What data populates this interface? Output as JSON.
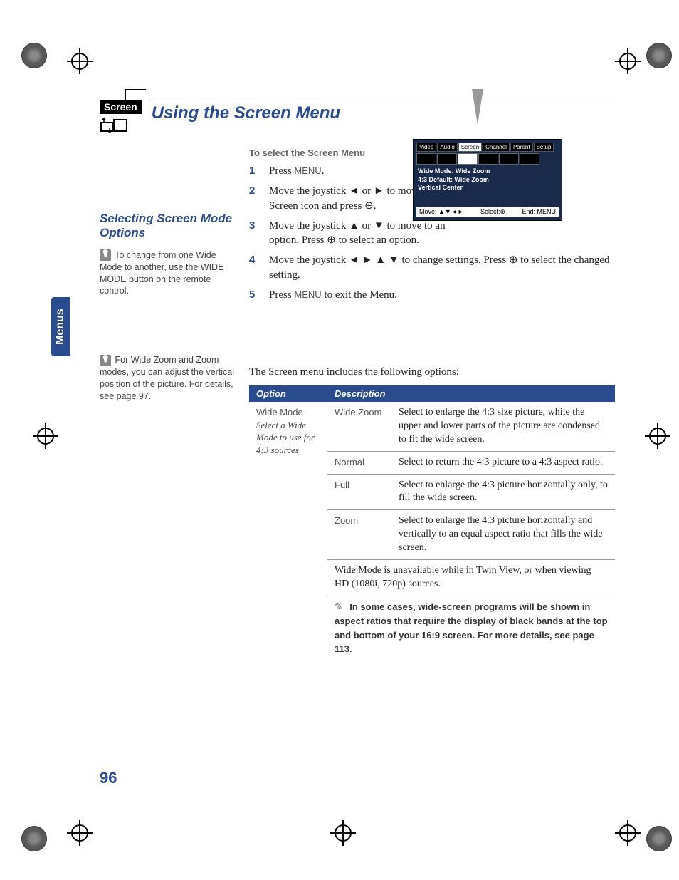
{
  "page_number": "96",
  "side_tab": "Menus",
  "header": {
    "screen_tag": "Screen",
    "title": "Using the Screen Menu"
  },
  "instructions": {
    "title": "To select the Screen Menu",
    "steps": [
      {
        "num": "1",
        "pre": "Press ",
        "key": "MENU",
        "post": "."
      },
      {
        "num": "2",
        "text": "Move the joystick ◄ or ► to move to the Screen icon and press ⊕."
      },
      {
        "num": "3",
        "text": "Move the joystick ▲ or ▼ to move to an option. Press ⊕ to select an option."
      },
      {
        "num": "4",
        "text": "Move the joystick ◄ ► ▲ ▼ to change settings. Press ⊕ to select the changed setting."
      },
      {
        "num": "5",
        "pre": "Press ",
        "key": "MENU",
        "post": " to exit the Menu."
      }
    ]
  },
  "osd": {
    "tabs": [
      "Video",
      "Audio",
      "Screen",
      "Channel",
      "Parent",
      "Setup"
    ],
    "active_tab_index": 2,
    "body_lines": [
      "Wide Mode: Wide Zoom",
      "4:3 Default: Wide Zoom",
      "Vertical Center"
    ],
    "footer": {
      "move": "Move:",
      "select": "Select:⊕",
      "end": "End: MENU"
    }
  },
  "section": {
    "title": "Selecting Screen Mode Options",
    "tip1": "To change from one Wide Mode to another, use the WIDE MODE button on the remote control.",
    "tip2": "For Wide Zoom and Zoom modes, you can adjust the vertical position of the picture. For details, see page 97."
  },
  "options_intro": "The Screen menu includes the following options:",
  "table": {
    "head": {
      "option": "Option",
      "description": "Description"
    },
    "wide_mode": {
      "name": "Wide Mode",
      "sub": "Select a Wide Mode to use for 4:3 sources",
      "rows": [
        {
          "label": "Wide Zoom",
          "desc": "Select to enlarge the 4:3 size picture, while the upper and lower parts of the picture are condensed to fit the wide screen."
        },
        {
          "label": "Normal",
          "desc": "Select to return the 4:3 picture to a 4:3 aspect ratio."
        },
        {
          "label": "Full",
          "desc": "Select to enlarge the 4:3 picture horizontally only, to fill the wide screen."
        },
        {
          "label": "Zoom",
          "desc": "Select to enlarge the 4:3 picture horizontally and vertically to an equal aspect ratio that fills the wide screen."
        }
      ],
      "note": "Wide Mode is unavailable while in Twin View, or when viewing HD (1080i, 720p) sources.",
      "callout": "In some cases, wide-screen programs will be shown in aspect ratios that require the display of black bands at the top and bottom of your 16:9 screen. For more details, see page 113."
    }
  }
}
